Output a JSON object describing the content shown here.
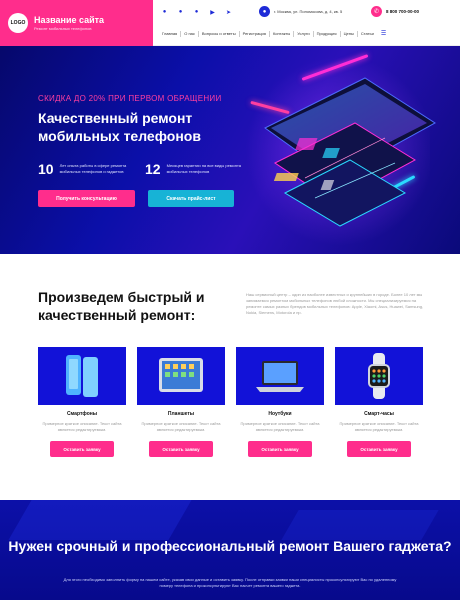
{
  "header": {
    "logo_text": "LOGO",
    "site_name": "Название сайта",
    "tagline": "Ремонт мобильных телефонов",
    "social_icons": [
      "vk-icon",
      "twitter-icon",
      "facebook-icon",
      "youtube-icon",
      "telegram-icon"
    ],
    "social_glyphs": [
      "●",
      "●",
      "●",
      "▶",
      "➤"
    ],
    "address": "г. Москва, ул. Пономосова, д. 4, кв. 5",
    "phone": "8 800 700-00-00",
    "nav": [
      "Главная",
      "О нас",
      "Вопросы и ответы",
      "Регистрация",
      "Контакты",
      "Услуги",
      "Продукция",
      "Цены",
      "Статьи"
    ]
  },
  "hero": {
    "promo": "СКИДКА ДО 20% ПРИ ПЕРВОМ ОБРАЩЕНИИ",
    "title": "Качественный ремонт мобильных телефонов",
    "stat1_num": "10",
    "stat1_text": "Лет опыта работы в сфере ремонта мобильных телефонов и гаджетов",
    "stat2_num": "12",
    "stat2_text": "Месяцев гарантии на все виды ремонта мобильных телефонов",
    "btn_consult": "Получить консультацию",
    "btn_price": "Скачать прайс-лист"
  },
  "services": {
    "title": "Произведем быстрый и качественный ремонт:",
    "description": "Наш сервисный центр – один из наиболее известных и крупнейших в городе. Более 10 лет мы занимаемся ремонтом мобильных телефонов любой сложности. Мы специализируемся на ремонте самых разных брендов мобильных телефонов: Apple, Xiaomi, Asus, Huawei, Samsung, Nokia, Siemens, Motorola и пр.",
    "cards": [
      {
        "title": "Смартфоны",
        "desc": "Примерное краткое описание. Текст сайта является редактируемым.",
        "button": "Оставить заявку"
      },
      {
        "title": "Планшеты",
        "desc": "Примерное краткое описание. Текст сайта является редактируемым.",
        "button": "Оставить заявку"
      },
      {
        "title": "Ноутбуки",
        "desc": "Примерное краткое описание. Текст сайта является редактируемым.",
        "button": "Оставить заявку"
      },
      {
        "title": "Смарт-часы",
        "desc": "Примерное краткое описание. Текст сайта является редактируемым.",
        "button": "Оставить заявку"
      }
    ]
  },
  "cta": {
    "title": "Нужен срочный и профессиональный ремонт Вашего гаджета?",
    "description": "Для этого необходимо заполнить форму на нашем сайте, указав свои данные и оставить заявку. После отправки заявки наши специалисты проконсультируют Вас по удаленному номеру телефона и проконсультируют Вас насчет ремонта вашего гаджета."
  },
  "colors": {
    "accent_pink": "#ff2d8c",
    "accent_cyan": "#17b3d6",
    "brand_blue": "#1212d8",
    "hero_dark": "#06086b"
  }
}
